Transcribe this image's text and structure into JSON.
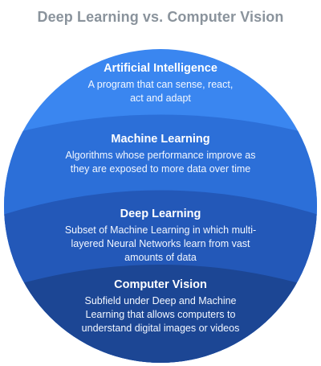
{
  "title": "Deep Learning vs. Computer Vision",
  "colors": {
    "title": "#8a939c",
    "ai_layer": "#3a86f0",
    "ml_layer": "#2c6fd8",
    "dl_layer": "#2358b8",
    "cv_layer": "#1c4694",
    "text": "#ffffff"
  },
  "layers": [
    {
      "title": "Artificial Intelligence",
      "description": "A program that can sense, react, act and adapt"
    },
    {
      "title": "Machine Learning",
      "description": "Algorithms whose performance improve as they are exposed to more data over time"
    },
    {
      "title": "Deep Learning",
      "description": "Subset of Machine Learning in which multi-layered Neural Networks learn from vast amounts of data"
    },
    {
      "title": "Computer Vision",
      "description": "Subfield under Deep and Machine Learning that allows computers to understand digital images or videos"
    }
  ]
}
